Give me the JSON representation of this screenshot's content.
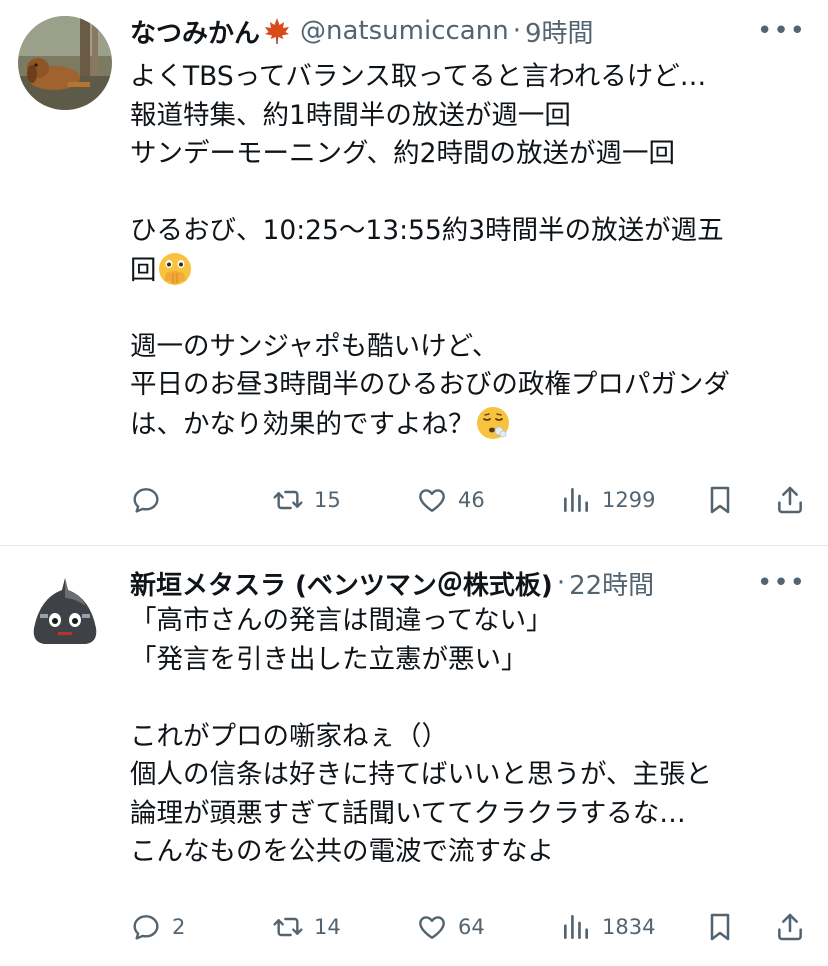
{
  "tweets": [
    {
      "author_name": "なつみかん",
      "handle": "@natsumiccann",
      "separator": "·",
      "time": "9時間",
      "more": "•••",
      "lines": [
        "よくTBSってバランス取ってると言われるけど…",
        "報道特集、約1時間半の放送が週一回",
        "サンデーモーニング、約2時間の放送が週一回",
        "",
        "ひるおび、10:25〜13:55約3時間半の放送が週五",
        "回",
        "",
        "週一のサンジャポも酷いけど、",
        "平日のお昼3時間半のひるおびの政権プロパガンダ",
        "は、かなり効果的ですよね？"
      ],
      "emojis": [
        "face-with-open-eyes-and-hand-over-mouth",
        "face-exhaling"
      ],
      "name_emoji": "maple-leaf",
      "stats": {
        "replies": "",
        "retweets": "15",
        "likes": "46",
        "views": "1299"
      }
    },
    {
      "author_name": "新垣メタスラ (ベンツマン＠株式板)",
      "handle": "",
      "separator": "·",
      "time": "22時間",
      "more": "•••",
      "lines": [
        "「高市さんの発言は間違ってない」",
        "「発言を引き出した立憲が悪い」",
        "",
        "これがプロの噺家ねぇ（）",
        "個人の信条は好きに持てばいいと思うが、主張と",
        "論理が頭悪すぎて話聞いててクラクラするな…",
        "こんなものを公共の電波で流すなよ"
      ],
      "stats": {
        "replies": "2",
        "retweets": "14",
        "likes": "64",
        "views": "1834"
      }
    }
  ],
  "colors": {
    "text": "#0f1419",
    "secondary": "#536471",
    "divider": "#e6e9ec",
    "background": "#ffffff"
  },
  "icons": [
    "reply-icon",
    "retweet-icon",
    "like-icon",
    "views-icon",
    "bookmark-icon",
    "share-icon"
  ]
}
